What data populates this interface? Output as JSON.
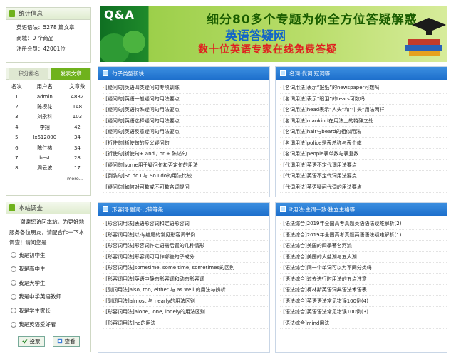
{
  "stats": {
    "title": "统计信息",
    "rows": [
      "英语语法：5278 篇文章",
      "商城：0 个商品",
      "注册会员：42001位"
    ]
  },
  "ranking": {
    "tabs": [
      "积分排名",
      "发表文章"
    ],
    "headers": [
      "名次",
      "用户名",
      "文章数"
    ],
    "rows": [
      [
        "1",
        "admin",
        "4832"
      ],
      [
        "2",
        "陈模花",
        "148"
      ],
      [
        "3",
        "刘永科",
        "103"
      ],
      [
        "4",
        "李翔",
        "42"
      ],
      [
        "5",
        "lx612800",
        "34"
      ],
      [
        "6",
        "陈仁祐",
        "34"
      ],
      [
        "7",
        "best",
        "28"
      ],
      [
        "8",
        "周云波",
        "17"
      ]
    ],
    "more": "more..."
  },
  "survey": {
    "title": "本站调查",
    "intro": "谢谢您访问本站。为更好地服务各位朋友，请配合作一下本调查！请问您是",
    "options": [
      "我是初中生",
      "我是高中生",
      "我是大学生",
      "我是中学英语教师",
      "我是学生家长",
      "我是英语爱好者"
    ],
    "vote": "投票",
    "view": "查看"
  },
  "banner": {
    "qa": "Q&A",
    "line1": "细分80多个专题为你全方位答疑解惑",
    "line2": "英语答疑网",
    "line3": "数十位英语专家在线免费答疑"
  },
  "panels": [
    {
      "title": "句子类型新块",
      "items": [
        "[疑问句]英语四类疑问句专项训练",
        "[疑问句]英语一般疑问句用法要点",
        "[疑问句]英语特殊疑问句用法要点",
        "[疑问句]英语选择疑问句用法要点",
        "[疑问句]英语反意疑问句用法要点",
        "[祈使句]祈使句的反义疑问句",
        "[祈使句]祈使句+ and  / or + 陈述句",
        "[疑问句]some用于疑问句和否定句的用法",
        "[倒装句]So  do  I  与  So  I  do的用法比较",
        "[疑问句]如何对可数或不可数名词提问"
      ]
    },
    {
      "title": "名词·代词·冠词等",
      "items": [
        "[名词用法]表示“报纸”的newspaper可数吗",
        "[名词用法]表示“眼泪”的tears可数吗",
        "[名词用法]head表示“人头”和“牛头”用法两样",
        "[名词用法]mankind在用法上的特殊之处",
        "[名词用法]hair与beard的相似用法",
        "[名词用法]police是表总称与表个体",
        "[名词用法]people表单数与表复数",
        "[代词用法]英语不定代词用法要点",
        "[代词用法]英语不定代词用法要点",
        "[代词用法]英语疑问代词的用法要点"
      ]
    },
    {
      "title": "形容词·副词·比较等级",
      "items": [
        "[形容词用法]表语形容词和定语形容词",
        "[形容词用法]以-ly结尾的常见形容词举例",
        "[形容词用法]形容词作定语需后置的几种情形",
        "[形容词用法]形容词可用作哪些句子成分",
        "[形容词用法]sometime,  some  time,  sometimes的区别",
        "[形容词用法]英语中静态形容词和动态形容词",
        "[副词用法]also,  too,  either  与  as  well  的用法与辨析",
        "[副词用法]almost  与  nearly的用法区别",
        "[形容词用法]alone,  lone,  lonely的用法区别",
        "[形容词用法]no的用法"
      ]
    },
    {
      "title": "it用法·主谓一致·独立主格等",
      "items": [
        "[语法综合]2019年全国高考真题英语语法疑难解析(2)",
        "[语法综合]2019年全国高考真题英语语法疑难解析(1)",
        "[语法综合]美国的四季著名河流",
        "[语法综合]美国的大盐湖与五大湖",
        "[语法综合]同一个单词可以为不同分类吗",
        "[语法综合]过去进行时用法的五点注意",
        "[语法综合]柯林斯英语词典语法术语表",
        "[语法综合]英语语法常见错误100例(4)",
        "[语法综合]英语语法常见错误100例(3)",
        "[语法综合]mind用法"
      ]
    }
  ],
  "colors": {
    "green_accent": "#6fb21c",
    "blue_header": "#1d6fcc",
    "banner_red": "#e02020",
    "banner_blue": "#1164c9"
  }
}
